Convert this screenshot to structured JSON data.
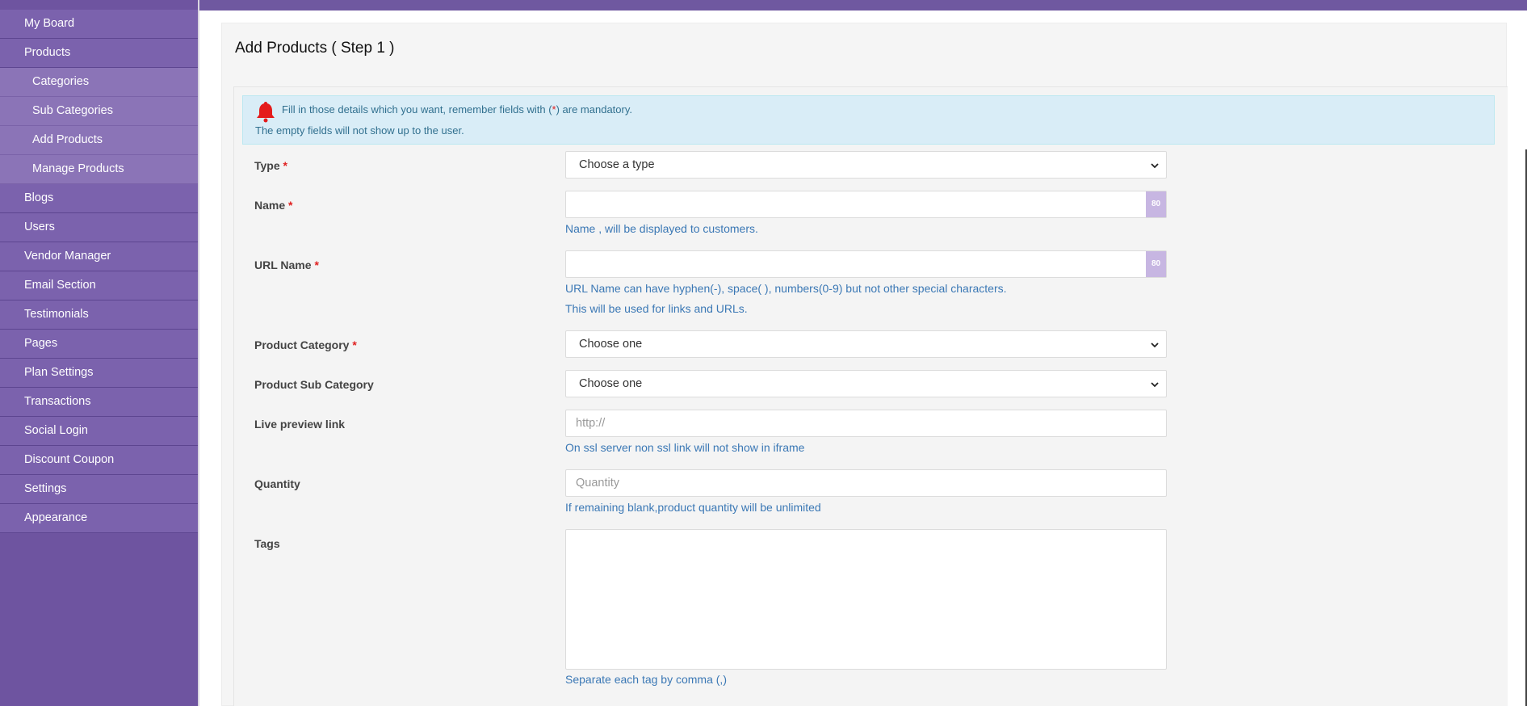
{
  "sidebar": {
    "items": [
      {
        "label": "My Board"
      },
      {
        "label": "Products"
      },
      {
        "label": "Categories"
      },
      {
        "label": "Sub Categories"
      },
      {
        "label": "Add Products"
      },
      {
        "label": "Manage Products"
      },
      {
        "label": "Blogs"
      },
      {
        "label": "Users"
      },
      {
        "label": "Vendor Manager"
      },
      {
        "label": "Email Section"
      },
      {
        "label": "Testimonials"
      },
      {
        "label": "Pages"
      },
      {
        "label": "Plan Settings"
      },
      {
        "label": "Transactions"
      },
      {
        "label": "Social Login"
      },
      {
        "label": "Discount Coupon"
      },
      {
        "label": "Settings"
      },
      {
        "label": "Appearance"
      }
    ]
  },
  "page": {
    "title": "Add Products ( Step 1 )"
  },
  "alert": {
    "icon": "bell-icon",
    "line1_a": "Fill in those details which you want, remember fields with (",
    "line1_star": "*",
    "line1_b": ") are mandatory.",
    "line2": "The empty fields will not show up to the user."
  },
  "form": {
    "type": {
      "label": "Type",
      "required": "*",
      "value": "Choose a type"
    },
    "name": {
      "label": "Name",
      "required": "*",
      "counter": "80",
      "help": "Name , will be displayed to customers."
    },
    "url_name": {
      "label": "URL Name",
      "required": "*",
      "counter": "80",
      "help1": "URL Name can have hyphen(-), space( ), numbers(0-9) but not other special characters.",
      "help2": "This will be used for links and URLs."
    },
    "category": {
      "label": "Product Category",
      "required": "*",
      "value": "Choose one"
    },
    "sub_category": {
      "label": "Product Sub Category",
      "value": "Choose one"
    },
    "preview": {
      "label": "Live preview link",
      "placeholder": "http://",
      "help": "On ssl server non ssl link will not show in iframe"
    },
    "quantity": {
      "label": "Quantity",
      "placeholder": "Quantity",
      "help": "If remaining blank,product quantity will be unlimited"
    },
    "tags": {
      "label": "Tags",
      "help": "Separate each tag by comma (,)"
    }
  },
  "colors": {
    "sidebar": "#6e54a0",
    "accent_counter": "#c7b6e2",
    "help_text": "#3b78b5",
    "required": "#e02020",
    "alert_bg": "#d9edf7"
  }
}
